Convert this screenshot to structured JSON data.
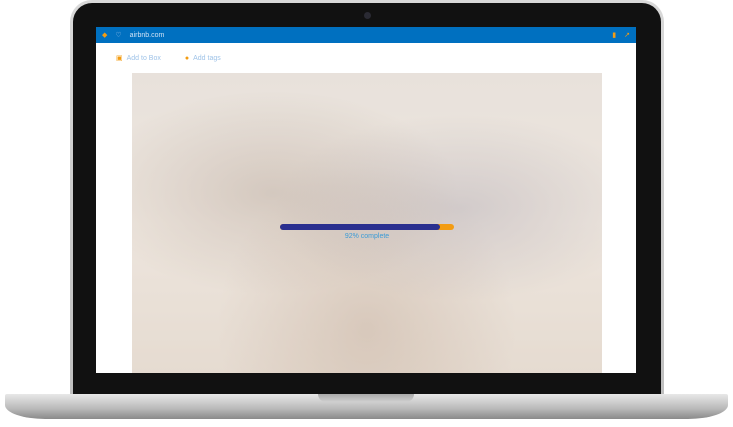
{
  "browser": {
    "url": "airbnb.com",
    "back_icon": "back-arrow-icon",
    "shield_icon": "shield-icon",
    "trash_icon": "trash-icon",
    "share_icon": "share-icon"
  },
  "actions": {
    "add_to_box": "Add to Box",
    "add_tags": "Add tags"
  },
  "upload": {
    "progress_percent": 92,
    "label": "92% complete",
    "colors": {
      "fill": "#2a2f8f",
      "track": "#f39c12",
      "label": "#3b9bd6",
      "bar": "#0070c0"
    }
  }
}
